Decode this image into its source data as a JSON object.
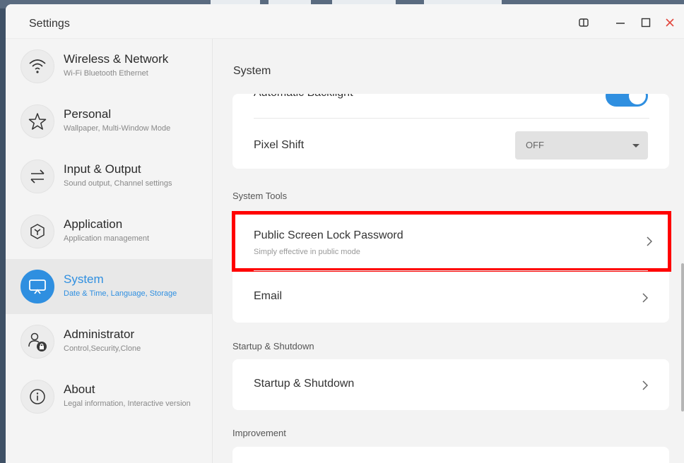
{
  "window": {
    "title": "Settings"
  },
  "titlebar_controls": [
    "split-view-icon",
    "minimize-icon",
    "maximize-icon",
    "close-icon"
  ],
  "sidebar": {
    "items": [
      {
        "title": "Wireless & Network",
        "subtitle": "Wi-Fi Bluetooth Ethernet",
        "icon": "wifi-icon",
        "active": false
      },
      {
        "title": "Personal",
        "subtitle": "Wallpaper, Multi-Window Mode",
        "icon": "star-icon",
        "active": false
      },
      {
        "title": "Input & Output",
        "subtitle": "Sound output, Channel settings",
        "icon": "swap-arrows-icon",
        "active": false
      },
      {
        "title": "Application",
        "subtitle": "Application management",
        "icon": "cube-icon",
        "active": false
      },
      {
        "title": "System",
        "subtitle": "Date & Time, Language, Storage",
        "icon": "monitor-icon",
        "active": true
      },
      {
        "title": "Administrator",
        "subtitle": "Control,Security,Clone",
        "icon": "admin-lock-icon",
        "active": false
      },
      {
        "title": "About",
        "subtitle": "Legal information, Interactive version",
        "icon": "info-icon",
        "active": false
      }
    ]
  },
  "main": {
    "page_title": "System",
    "display_card": {
      "backlight_label": "Automatic Backlight",
      "backlight_on": true,
      "pixel_shift_label": "Pixel Shift",
      "pixel_shift_value": "OFF"
    },
    "system_tools": {
      "section_label": "System Tools",
      "lock_title": "Public Screen Lock Password",
      "lock_sub": "Simply effective in public mode",
      "email_title": "Email"
    },
    "startup": {
      "section_label": "Startup & Shutdown",
      "row_title": "Startup & Shutdown"
    },
    "improvement": {
      "section_label": "Improvement"
    }
  },
  "colors": {
    "accent": "#2f8fe0",
    "highlight": "#ff0000",
    "close": "#e2453c"
  }
}
